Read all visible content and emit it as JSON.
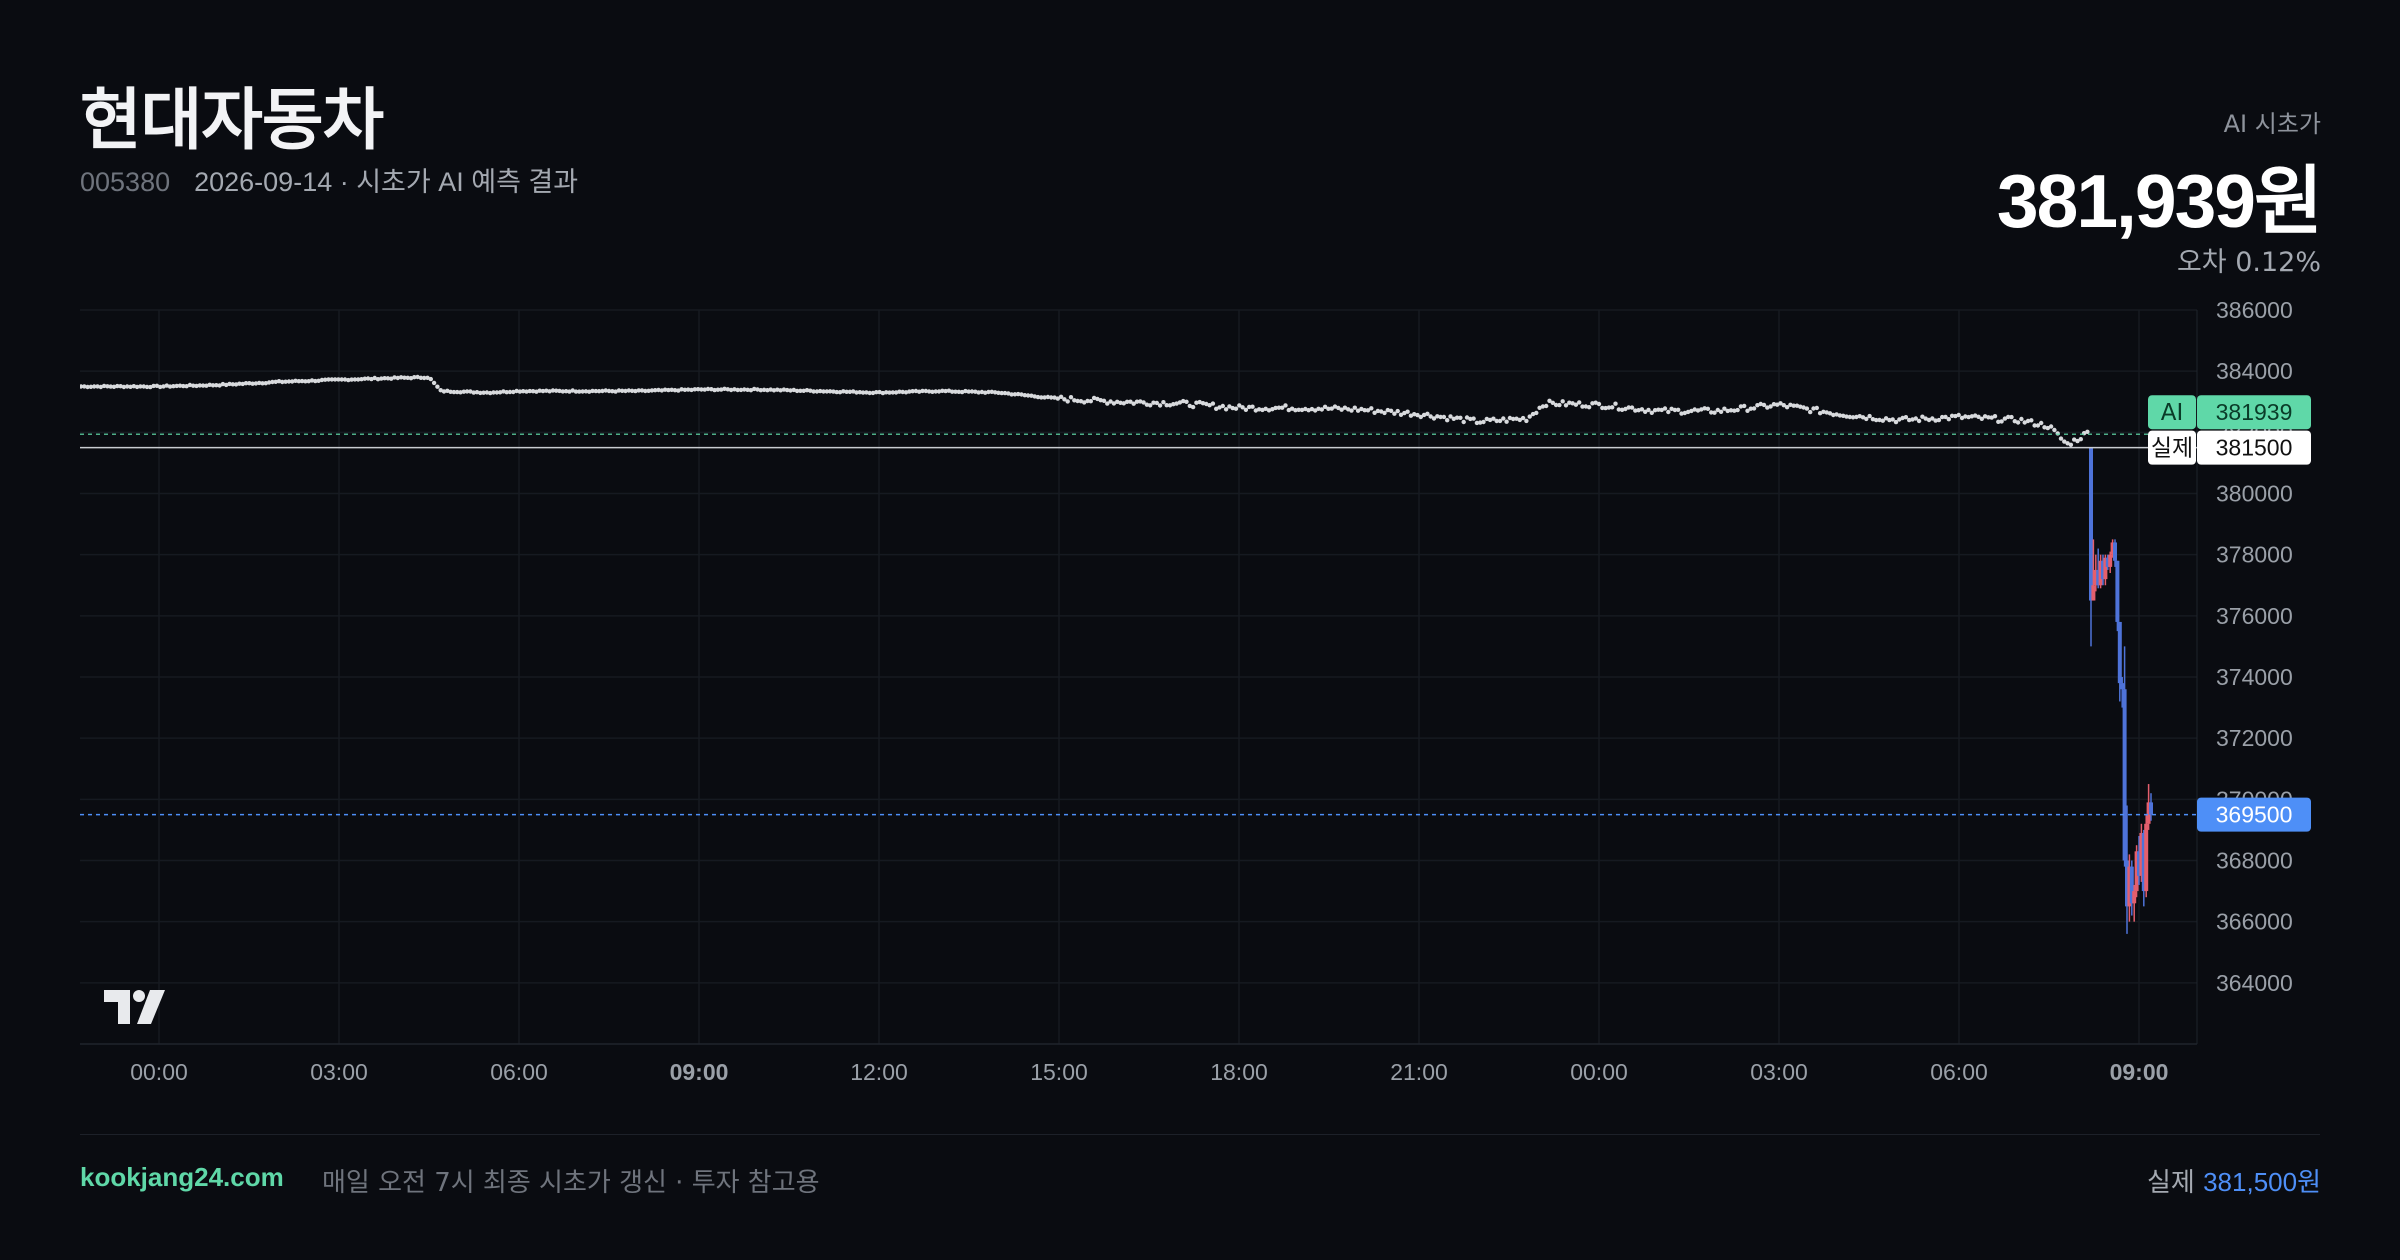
{
  "header": {
    "title": "현대자동차",
    "code": "005380",
    "meta": "2026-09-14 · 시초가 AI 예측 결과"
  },
  "prediction": {
    "label": "AI 시초가",
    "value": "381,939원",
    "error": "오차 0.12%"
  },
  "footer": {
    "site": "kookjang24.com",
    "note": "매일 오전 7시 최종 시초가 갱신 · 투자 참고용",
    "actual_label": "실제",
    "actual_value": "381,500원"
  },
  "colors": {
    "background": "#0a0c11",
    "ai_accent": "#5fd8a8",
    "actual_accent": "#4e8ff7",
    "candle_up": "#e45f6d",
    "candle_down": "#4e73d9",
    "dots": "#d8dadd"
  },
  "chart_data": {
    "type": "candlestick",
    "ylim": [
      363000,
      386000
    ],
    "y_ticks": [
      386000,
      384000,
      382000,
      380000,
      378000,
      376000,
      374000,
      372000,
      370000,
      368000,
      366000,
      364000
    ],
    "x_ticks": [
      {
        "label": "00:00",
        "hour": 0,
        "bold": false
      },
      {
        "label": "03:00",
        "hour": 3,
        "bold": false
      },
      {
        "label": "06:00",
        "hour": 6,
        "bold": false
      },
      {
        "label": "09:00",
        "hour": 9,
        "bold": true
      },
      {
        "label": "12:00",
        "hour": 12,
        "bold": false
      },
      {
        "label": "15:00",
        "hour": 15,
        "bold": false
      },
      {
        "label": "18:00",
        "hour": 18,
        "bold": false
      },
      {
        "label": "21:00",
        "hour": 21,
        "bold": false
      },
      {
        "label": "00:00",
        "hour": 24,
        "bold": false
      },
      {
        "label": "03:00",
        "hour": 27,
        "bold": false
      },
      {
        "label": "06:00",
        "hour": 30,
        "bold": false
      },
      {
        "label": "09:00",
        "hour": 33,
        "bold": true
      }
    ],
    "x_range_hours": [
      -1.3,
      34.0
    ],
    "prediction_series": [
      [
        -1.3,
        383500
      ],
      [
        0,
        383500
      ],
      [
        1,
        383550
      ],
      [
        2,
        383650
      ],
      [
        3,
        383720
      ],
      [
        4,
        383780
      ],
      [
        4.5,
        383800
      ],
      [
        4.7,
        383350
      ],
      [
        5.5,
        383300
      ],
      [
        6,
        383350
      ],
      [
        8,
        383350
      ],
      [
        9,
        383400
      ],
      [
        10,
        383400
      ],
      [
        11,
        383350
      ],
      [
        12,
        383300
      ],
      [
        13,
        383350
      ],
      [
        14,
        383300
      ],
      [
        15,
        383100
      ],
      [
        16,
        383000
      ],
      [
        17,
        382950
      ],
      [
        18,
        382800
      ],
      [
        19,
        382800
      ],
      [
        20,
        382750
      ],
      [
        21,
        382600
      ],
      [
        22,
        382350
      ],
      [
        22.8,
        382450
      ],
      [
        23.1,
        382950
      ],
      [
        24,
        382900
      ],
      [
        25,
        382700
      ],
      [
        26,
        382700
      ],
      [
        27,
        382900
      ],
      [
        28,
        382600
      ],
      [
        29,
        382400
      ],
      [
        30,
        382500
      ],
      [
        31,
        382400
      ],
      [
        31.5,
        382200
      ],
      [
        31.8,
        381600
      ],
      [
        32.0,
        381800
      ],
      [
        32.15,
        382000
      ]
    ],
    "ai_line": {
      "label": "AI",
      "value": 381939
    },
    "actual_line": {
      "label": "실제",
      "value": 381500
    },
    "last_price": {
      "value": 369500
    },
    "candles": [
      [
        32.2,
        381500,
        381500,
        375000,
        376500
      ],
      [
        32.24,
        376500,
        378500,
        376500,
        377000
      ],
      [
        32.28,
        377000,
        378000,
        376800,
        377500
      ],
      [
        32.32,
        377500,
        378200,
        376900,
        377000
      ],
      [
        32.36,
        377000,
        378000,
        376900,
        377800
      ],
      [
        32.4,
        377800,
        378000,
        377000,
        377200
      ],
      [
        32.44,
        377200,
        378000,
        377000,
        377900
      ],
      [
        32.48,
        377900,
        378000,
        377500,
        377600
      ],
      [
        32.52,
        377600,
        378100,
        377400,
        378000
      ],
      [
        32.56,
        378000,
        378500,
        377900,
        378400
      ],
      [
        32.6,
        378400,
        378500,
        377600,
        377800
      ],
      [
        32.64,
        377800,
        377800,
        375500,
        375800
      ],
      [
        32.68,
        375800,
        375800,
        373200,
        373800
      ],
      [
        32.72,
        373800,
        374000,
        373000,
        373600
      ],
      [
        32.76,
        373600,
        375000,
        367800,
        368000
      ],
      [
        32.8,
        368000,
        369800,
        365600,
        366500
      ],
      [
        32.84,
        366500,
        368200,
        366000,
        367800
      ],
      [
        32.88,
        367800,
        368000,
        366200,
        366600
      ],
      [
        32.92,
        366600,
        367200,
        366000,
        367000
      ],
      [
        32.96,
        367000,
        368500,
        366800,
        368300
      ],
      [
        33.0,
        368300,
        368800,
        367200,
        367500
      ],
      [
        33.04,
        367500,
        369200,
        367300,
        368900
      ],
      [
        33.08,
        368900,
        369000,
        366500,
        367000
      ],
      [
        33.12,
        367000,
        369500,
        366800,
        369200
      ],
      [
        33.16,
        369200,
        370500,
        369000,
        369900
      ],
      [
        33.2,
        369900,
        370200,
        369300,
        369500
      ]
    ]
  }
}
